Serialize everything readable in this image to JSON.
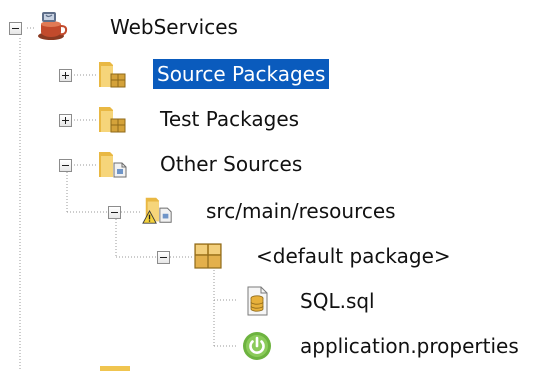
{
  "tree": {
    "nodes": [
      {
        "label": "WebServices",
        "toggle": "collapse",
        "icon": "project-coffee-icon"
      },
      {
        "label": "Source Packages",
        "toggle": "expand",
        "icon": "source-packages-folder-icon",
        "selected": true
      },
      {
        "label": "Test Packages",
        "toggle": "expand",
        "icon": "test-packages-folder-icon"
      },
      {
        "label": "Other Sources",
        "toggle": "collapse",
        "icon": "other-sources-folder-icon"
      },
      {
        "label": "src/main/resources",
        "toggle": "collapse",
        "icon": "resources-folder-warning-icon"
      },
      {
        "label": "<default package>",
        "toggle": "collapse",
        "icon": "package-icon"
      },
      {
        "label": "SQL.sql",
        "icon": "sql-file-icon"
      },
      {
        "label": "application.properties",
        "icon": "spring-properties-icon"
      }
    ]
  },
  "colors": {
    "selection": "#0a5bbd",
    "text": "#111111"
  }
}
